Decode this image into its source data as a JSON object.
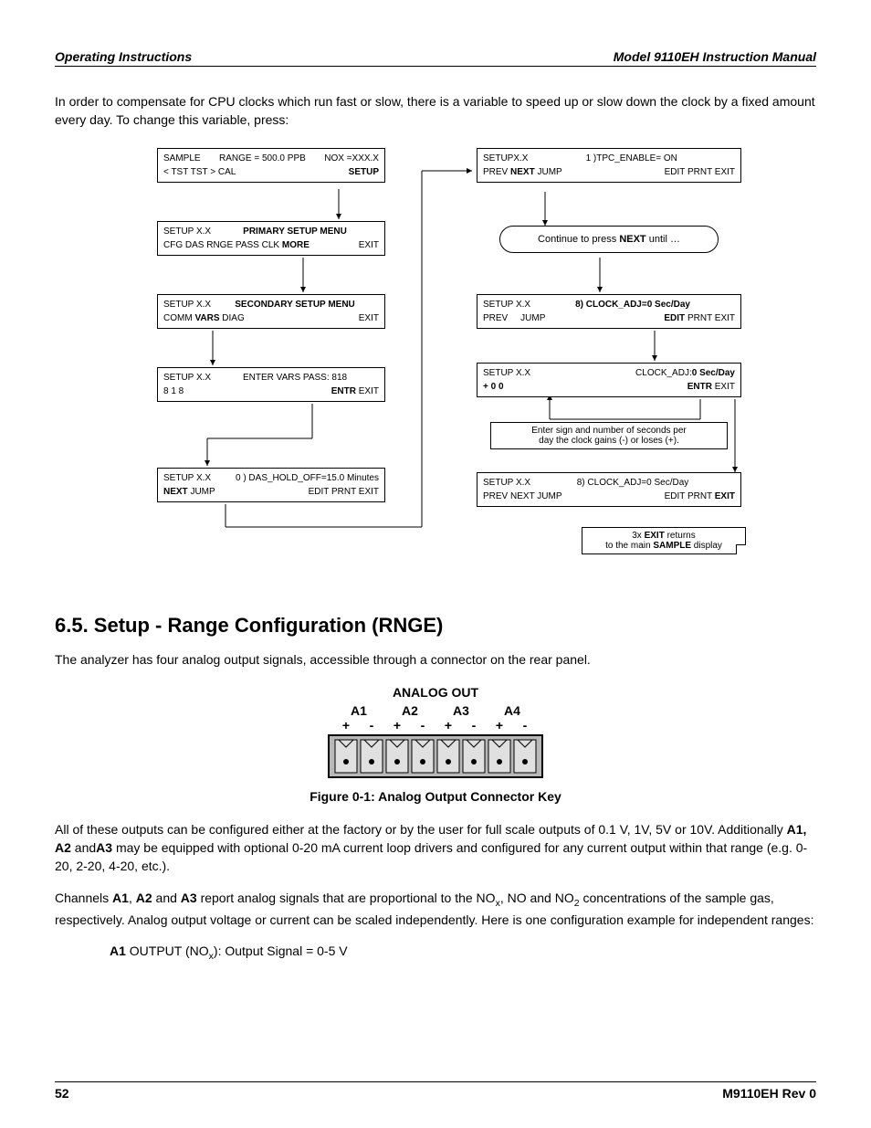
{
  "header": {
    "left": "Operating Instructions",
    "right": "Model 9110EH Instruction Manual"
  },
  "intro": "In order to compensate for CPU clocks which run fast or slow, there is a variable to speed up or slow down the clock by a fixed amount every day. To change this variable, press:",
  "flow": {
    "b1": {
      "l1l": "SAMPLE",
      "l1c": "RANGE = 500.0 PPB",
      "l1r": "NOX =XXX.X",
      "l2l": "< TST  TST >   CAL",
      "l2r": "SETUP"
    },
    "b2": {
      "l1l": "SETUP X.X",
      "l1c": "PRIMARY SETUP MENU",
      "l2l": "CFG  DAS  RNGE  PASS  CLK",
      "l2m": "MORE",
      "l2r": "EXIT"
    },
    "b3": {
      "l1l": "SETUP X.X",
      "l1c": "SECONDARY SETUP MENU",
      "l2l": "COMM",
      "l2m": "VARS",
      "l2m2": "DIAG",
      "l2r": "EXIT"
    },
    "b4": {
      "l1l": "SETUP X.X",
      "l1c": "ENTER VARS PASS: 818",
      "l2l": "8     1     8",
      "l2m": "ENTR",
      "l2r": "EXIT"
    },
    "b5": {
      "l1l": "SETUP X.X",
      "l1c": "0 )  DAS_HOLD_OFF=15.0  Minutes",
      "l2l": "NEXT",
      "l2m": "JUMP",
      "l2r": "EDIT  PRNT  EXIT"
    },
    "r1": {
      "l1l": "SETUPX.X",
      "l1c": "1 )TPC_ENABLE= ON",
      "l2l": "PREV",
      "l2m": "NEXT",
      "l2j": "JUMP",
      "l2r": "EDIT  PRNT  EXIT"
    },
    "oval": {
      "pre": "Continue to press ",
      "bold": "NEXT",
      "post": " until …"
    },
    "r2": {
      "l1l": "SETUP X.X",
      "l1c": "8)  CLOCK_ADJ=0  Sec/Day",
      "l2l": "PREV",
      "l2m": "JUMP",
      "l2e": "EDIT",
      "l2r": "PRNT  EXIT"
    },
    "r3": {
      "l1l": "SETUP X.X",
      "l1c": "CLOCK_ADJ:",
      "l1cb": "0  Sec/Day",
      "l2l": "+     0     0",
      "l2m": "ENTR",
      "l2r": "EXIT"
    },
    "n1a": "Enter sign and number of seconds per",
    "n1b": "day the clock gains (-) or loses (+).",
    "r4": {
      "l1l": "SETUP X.X",
      "l1c": "8)  CLOCK_ADJ=0  Sec/Day",
      "l2l": "PREV  NEXT  JUMP",
      "l2r": "EDIT  PRNT",
      "l2e": "EXIT"
    },
    "n2a": "3x ",
    "n2b": "EXIT",
    "n2c": " returns",
    "n2d": "to the main ",
    "n2e": "SAMPLE",
    "n2f": " display"
  },
  "section": "6.5. Setup - Range Configuration (RNGE)",
  "p2": "The analyzer has four analog output signals, accessible through a connector on the rear panel.",
  "connector": {
    "title": "ANALOG OUT",
    "labels": [
      "A1",
      "A2",
      "A3",
      "A4"
    ],
    "pm": [
      "+",
      "-",
      "+",
      "-",
      "+",
      "-",
      "+",
      "-"
    ]
  },
  "figcap": "Figure 0-1:   Analog Output Connector Key",
  "p3a": "All of these outputs can be configured either at the factory or by the user for full scale outputs of 0.1 V, 1V, 5V or 10V. Additionally ",
  "p3b": "A1, A2",
  "p3c": " and",
  "p3d": "A3",
  "p3e": " may be equipped with optional 0-20 mA current loop drivers and configured for any current output within that range (e.g. 0-20, 2-20, 4-20, etc.).",
  "p4a": "Channels ",
  "p4b": "A1",
  "p4c": ", ",
  "p4d": "A2",
  "p4e": " and ",
  "p4f": "A3",
  "p4g": " report analog signals that are proportional to the NO",
  "p4x": "x",
  "p4h": ", NO and NO",
  "p4y": "2",
  "p4i": " concentrations of the sample gas, respectively. Analog output voltage or current can be scaled independently. Here is one configuration example for independent ranges:",
  "p5a": "A1",
  "p5b": " OUTPUT (NO",
  "p5x": "x",
  "p5c": "): Output Signal = 0-5 V",
  "footer": {
    "left": "52",
    "right": "M9110EH Rev 0"
  }
}
